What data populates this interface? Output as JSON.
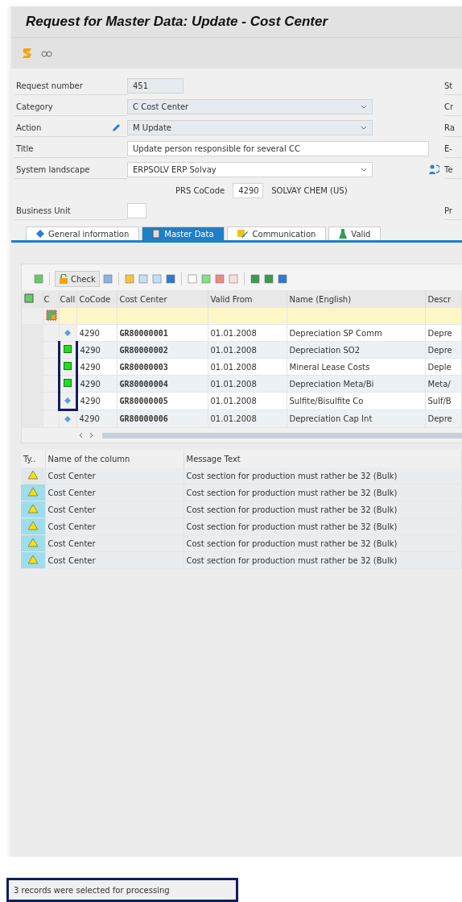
{
  "window": {
    "title": "Request for Master Data: Update - Cost Center"
  },
  "form": {
    "fields": [
      {
        "kind": "readonly",
        "label": "Request number",
        "value": "451",
        "side_label": "St"
      },
      {
        "kind": "dropdown",
        "label": "Category",
        "value": "C Cost Center",
        "side_label": "Cr"
      },
      {
        "kind": "dropdown",
        "label": "Action",
        "value": "M Update",
        "edit_icon": true,
        "side_label": "Ra"
      },
      {
        "kind": "text",
        "label": "Title",
        "value": "Update person responsible for several CC",
        "side_label": "E-"
      },
      {
        "kind": "select",
        "label": "System landscape",
        "value": "ERPSOLV ERP Solvay",
        "side_label": "Te",
        "side_icon": true
      },
      {
        "kind": "company",
        "label": "PRS CoCode",
        "value": "4290",
        "description": "SOLVAY CHEM (US)"
      },
      {
        "kind": "box",
        "label": "Business Unit",
        "side_label": "Pr"
      }
    ]
  },
  "tabs": [
    {
      "label": "General information",
      "selected": false
    },
    {
      "label": "Master Data",
      "selected": true
    },
    {
      "label": "Communication",
      "selected": false
    },
    {
      "label": "Valid",
      "selected": false
    }
  ],
  "grid": {
    "check_button": "Check",
    "columns": [
      "C",
      "Call",
      "CoCode",
      "Cost Center",
      "Valid From",
      "Name (English)",
      "Descr"
    ],
    "rows": [
      {
        "selected": false,
        "cocode": "4290",
        "cost_center": "GR80000001",
        "valid_from": "01.01.2008",
        "name": "Depreciation SP Comm",
        "descr": "Depre"
      },
      {
        "selected": true,
        "cocode": "4290",
        "cost_center": "GR80000002",
        "valid_from": "01.01.2008",
        "name": "Depreciation SO2",
        "descr": "Depre"
      },
      {
        "selected": true,
        "cocode": "4290",
        "cost_center": "GR80000003",
        "valid_from": "01.01.2008",
        "name": "Mineral Lease Costs",
        "descr": "Deple"
      },
      {
        "selected": true,
        "cocode": "4290",
        "cost_center": "GR80000004",
        "valid_from": "01.01.2008",
        "name": "Depreciation Meta/Bi",
        "descr": "Meta/"
      },
      {
        "selected": false,
        "cocode": "4290",
        "cost_center": "GR80000005",
        "valid_from": "01.01.2008",
        "name": "Sulfite/Bisulfite Co",
        "descr": "Sulf/B"
      },
      {
        "selected": false,
        "cocode": "4290",
        "cost_center": "GR80000006",
        "valid_from": "01.01.2008",
        "name": "Depreciation Cap Int",
        "descr": "Depre"
      }
    ]
  },
  "messages": {
    "columns": [
      "Ty..",
      "Name of the column",
      "Message Text"
    ],
    "rows": [
      {
        "selected": false,
        "column": "Cost Center",
        "text": "Cost section for production must rather be 32 (Bulk)"
      },
      {
        "selected": true,
        "column": "Cost Center",
        "text": "Cost section for production must rather be 32 (Bulk)"
      },
      {
        "selected": true,
        "column": "Cost Center",
        "text": "Cost section for production must rather be 32 (Bulk)"
      },
      {
        "selected": true,
        "column": "Cost Center",
        "text": "Cost section for production must rather be 32 (Bulk)"
      },
      {
        "selected": true,
        "column": "Cost Center",
        "text": "Cost section for production must rather be 32 (Bulk)"
      },
      {
        "selected": true,
        "column": "Cost Center",
        "text": "Cost section for production must rather be 32 (Bulk)"
      }
    ]
  },
  "status_bar": {
    "message": "3 records were selected for processing"
  }
}
